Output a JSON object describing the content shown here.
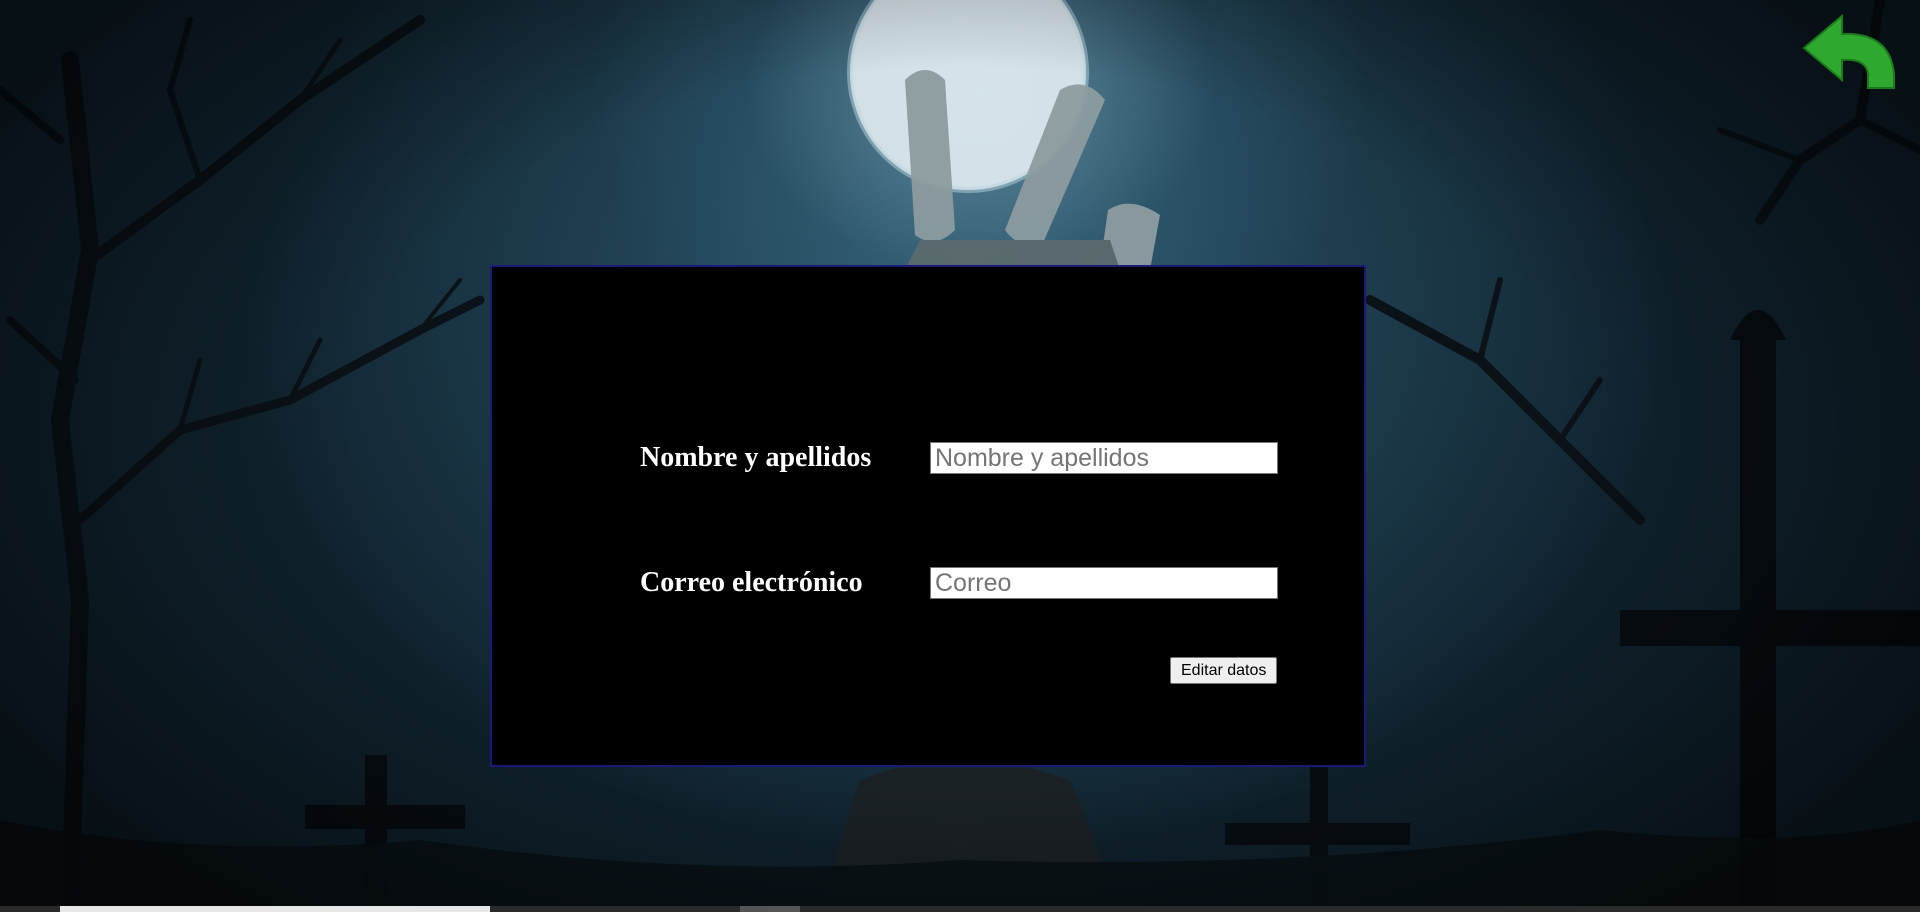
{
  "form": {
    "name_label": "Nombre y apellidos",
    "name_placeholder": "Nombre y apellidos",
    "name_value": "",
    "email_label": "Correo electrónico",
    "email_placeholder": "Correo",
    "email_value": "",
    "submit_label": "Editar datos"
  },
  "icons": {
    "back": "back-arrow-icon"
  },
  "colors": {
    "panel_background": "#000000",
    "panel_border": "#1a1a7a",
    "back_icon": "#2ea82e",
    "label_text": "#ffffff"
  }
}
